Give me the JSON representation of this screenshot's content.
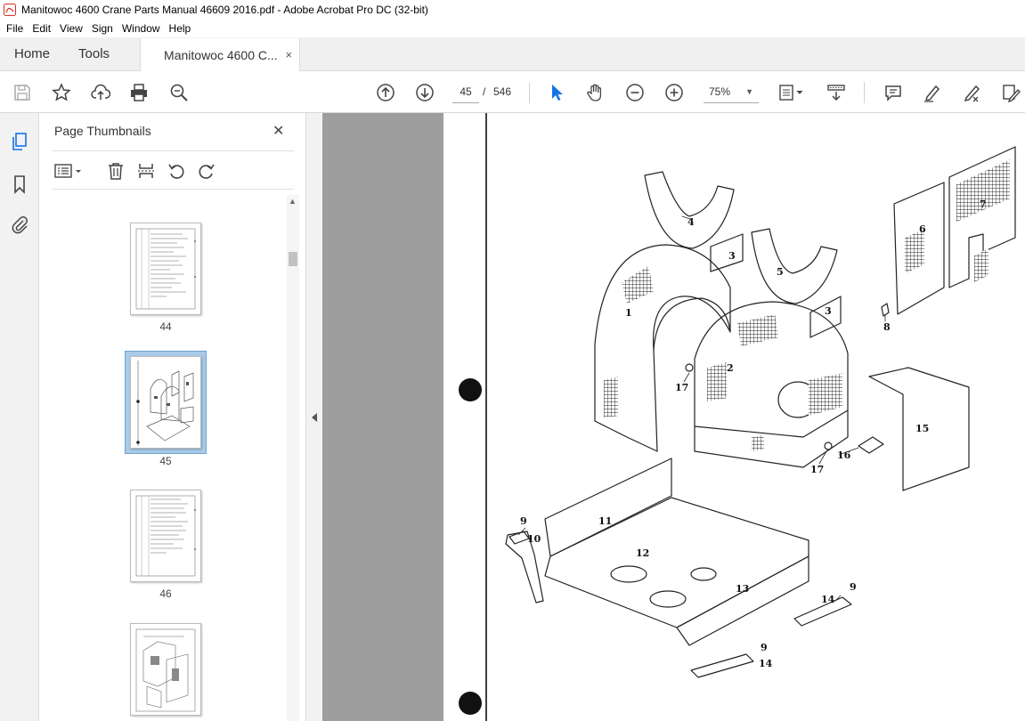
{
  "window": {
    "title": "Manitowoc 4600 Crane Parts Manual 46609 2016.pdf - Adobe Acrobat Pro DC (32-bit)"
  },
  "menu": [
    "File",
    "Edit",
    "View",
    "Sign",
    "Window",
    "Help"
  ],
  "tabs": {
    "home": "Home",
    "tools": "Tools",
    "document": "Manitowoc 4600 C...",
    "close": "×"
  },
  "toolbar": {
    "current_page": "45",
    "separator": "/",
    "total_pages": "546",
    "zoom": "75%"
  },
  "panel": {
    "title": "Page Thumbnails",
    "close": "✕",
    "thumbnails": [
      {
        "label": "44",
        "kind": "parts-list"
      },
      {
        "label": "45",
        "kind": "drawing",
        "selected": true
      },
      {
        "label": "46",
        "kind": "parts-list"
      },
      {
        "kind": "drawing"
      }
    ]
  },
  "drawing": {
    "callouts": [
      "1",
      "2",
      "3",
      "3",
      "4",
      "5",
      "6",
      "7",
      "8",
      "9",
      "9",
      "9",
      "10",
      "11",
      "12",
      "13",
      "14",
      "14",
      "15",
      "16",
      "17",
      "17"
    ]
  },
  "colors": {
    "accent": "#1473e6",
    "selection": "#a9cbe8",
    "viewport": "#9e9e9e"
  }
}
